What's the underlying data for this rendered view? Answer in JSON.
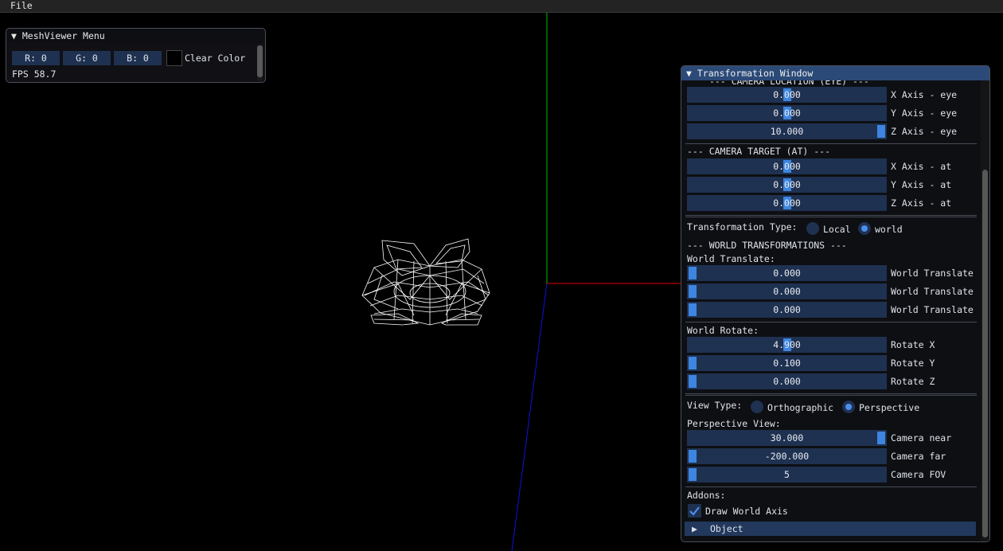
{
  "menubar": {
    "file": "File"
  },
  "meshviewer": {
    "title": "MeshViewer Menu",
    "r": "R:  0",
    "g": "G:  0",
    "b": "B:  0",
    "clear_color": "Clear Color",
    "fps": "FPS 58.7"
  },
  "transform": {
    "title": "Transformation Window",
    "camera_location_header": "--- CAMERA LOCATION (EYE) ---",
    "eye": [
      {
        "value": "0.000",
        "label": "X Axis - eye",
        "fraction": 0.5
      },
      {
        "value": "0.000",
        "label": "Y Axis - eye",
        "fraction": 0.5
      },
      {
        "value": "10.000",
        "label": "Z Axis - eye",
        "fraction": 1.0
      }
    ],
    "camera_target_header": "--- CAMERA TARGET (AT) ---",
    "at": [
      {
        "value": "0.000",
        "label": "X Axis - at",
        "fraction": 0.5
      },
      {
        "value": "0.000",
        "label": "Y Axis - at",
        "fraction": 0.5
      },
      {
        "value": "0.000",
        "label": "Z Axis - at",
        "fraction": 0.5
      }
    ],
    "transformation_type_label": "Transformation Type:",
    "local_label": "Local",
    "world_label": "world",
    "selected_transformation_type": "world",
    "world_transformations_header": "--- WORLD TRANSFORMATIONS ---",
    "world_translate_label": "World Translate:",
    "translate": [
      {
        "value": "0.000",
        "label": "World Translate",
        "fraction": 0.0
      },
      {
        "value": "0.000",
        "label": "World Translate",
        "fraction": 0.0
      },
      {
        "value": "0.000",
        "label": "World Translate",
        "fraction": 0.0
      }
    ],
    "world_rotate_label": "World Rotate:",
    "rotate": [
      {
        "value": "4.900",
        "label": "Rotate X",
        "fraction": 0.5
      },
      {
        "value": "0.100",
        "label": "Rotate Y",
        "fraction": 0.0
      },
      {
        "value": "0.000",
        "label": "Rotate Z",
        "fraction": 0.0
      }
    ],
    "view_type_label": "View Type:",
    "orthographic_label": "Orthographic",
    "perspective_label": "Perspective",
    "selected_view_type": "Perspective",
    "perspective_view_label": "Perspective View:",
    "perspective": [
      {
        "value": "30.000",
        "label": "Camera near",
        "fraction": 1.0
      },
      {
        "value": "-200.000",
        "label": "Camera far",
        "fraction": 0.0
      },
      {
        "value": "5",
        "label": "Camera FOV",
        "fraction": 0.0
      }
    ],
    "addons_label": "Addons:",
    "draw_world_axis_label": "Draw World Axis",
    "draw_world_axis_checked": true,
    "object_label": "Object"
  },
  "colors": {
    "axis_x": "#e00000",
    "axis_y": "#00c000",
    "axis_z": "#1010e0",
    "accent": "#3d85e0",
    "mesh": "#ffffff"
  }
}
